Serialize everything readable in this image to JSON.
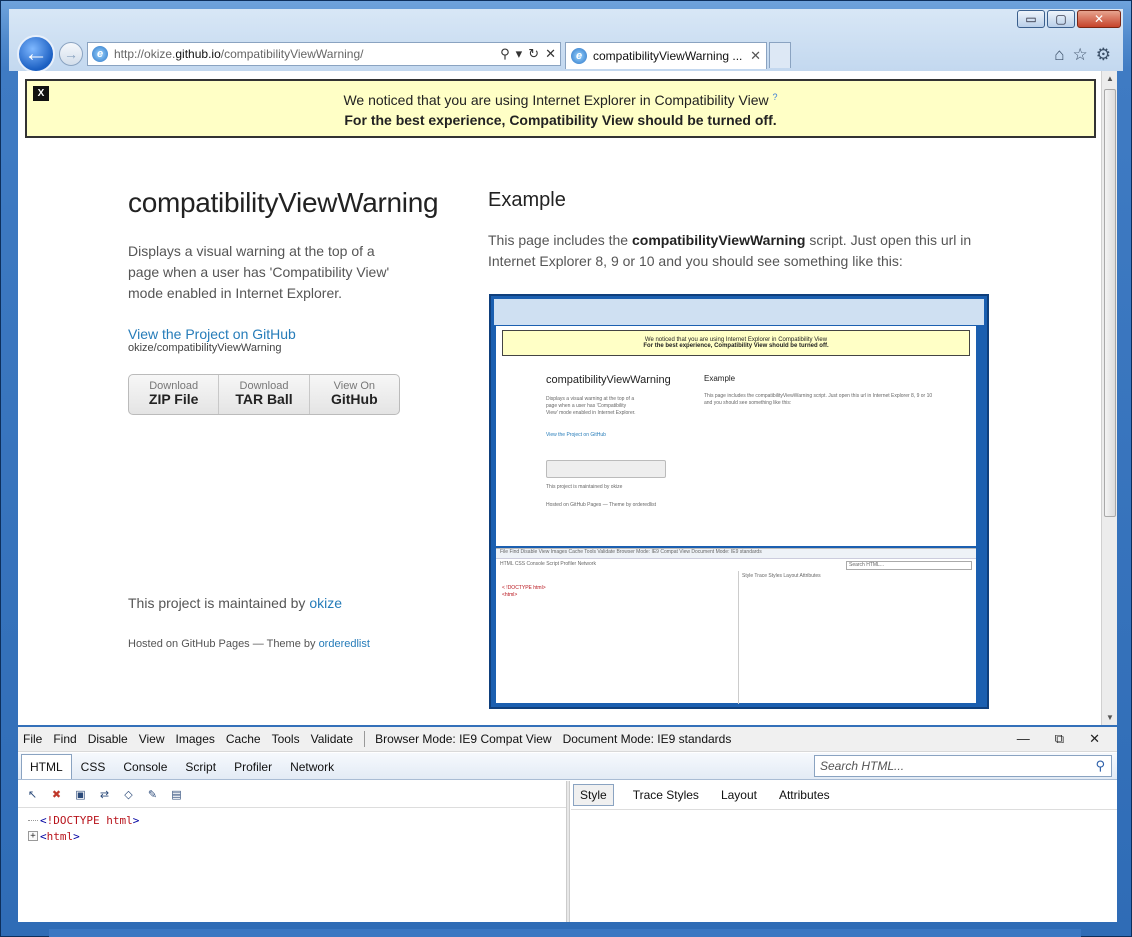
{
  "browser": {
    "address_url_prefix": "http://okize.",
    "address_url_domain": "github.io",
    "address_url_path": "/compatibilityViewWarning/",
    "tab_title": "compatibilityViewWarning ...",
    "window_controls": {
      "minimize": "▭",
      "maximize": "▢",
      "close": "✕"
    }
  },
  "banner": {
    "close_label": "X",
    "line1": "We noticed that you are using Internet Explorer in Compatibility View",
    "help_mark": "?",
    "line2": "For the best experience, Compatibility View should be turned off."
  },
  "page": {
    "title": "compatibilityViewWarning",
    "description": "Displays a visual warning at the top of a page when a user has 'Compatibility View' mode enabled in Internet Explorer.",
    "github_link": "View the Project on GitHub",
    "github_sub": "okize/compatibilityViewWarning",
    "downloads": [
      {
        "small": "Download",
        "big": "ZIP File"
      },
      {
        "small": "Download",
        "big": "TAR Ball"
      },
      {
        "small": "View On",
        "big": "GitHub"
      }
    ],
    "maintained_prefix": "This project is maintained by ",
    "maintained_user": "okize",
    "hosted_prefix": "Hosted on GitHub Pages — Theme by ",
    "hosted_theme": "orderedlist",
    "example_heading": "Example",
    "example_text_before": "This page includes the ",
    "example_text_bold": "compatibilityViewWarning",
    "example_text_after": " script. Just open this url in Internet Explorer 8, 9 or 10 and you should see something like this:"
  },
  "thumbnail": {
    "banner_line1": "We noticed that you are using Internet Explorer in Compatibility View",
    "banner_line2": "For the best experience, Compatibility View should be turned off.",
    "title": "compatibilityViewWarning",
    "example": "Example",
    "desc": "Displays a visual warning at the top of a page when a user has 'Compatibility View' mode enabled in Internet Explorer.",
    "example_text": "This page includes the compatibilityViewWarning script. Just open this url in Internet Explorer 8, 9 or 10 and you should see something like this:",
    "link": "View the Project on GitHub",
    "maint": "This project is maintained by okize",
    "hosted": "Hosted on GitHub Pages — Theme by orderedlist",
    "dev_menu": "File  Find  Disable  View  Images  Cache  Tools  Validate  Browser Mode: IE9 Compat View  Document Mode: IE9 standards",
    "dev_tabs": "HTML   CSS   Console   Script   Profiler   Network",
    "dev_right_tabs": "Style   Trace Styles   Layout   Attributes",
    "dev_search": "Search HTML...",
    "dev_tree": "< !DOCTYPE html>",
    "dev_tree2": "<html>"
  },
  "devtools": {
    "menu": [
      "File",
      "Find",
      "Disable",
      "View",
      "Images",
      "Cache",
      "Tools",
      "Validate"
    ],
    "browser_mode": "Browser Mode: IE9 Compat View",
    "document_mode": "Document Mode: IE9 standards",
    "tabs": [
      "HTML",
      "CSS",
      "Console",
      "Script",
      "Profiler",
      "Network"
    ],
    "active_tab": "HTML",
    "search_placeholder": "Search HTML...",
    "tree": {
      "doctype": "!DOCTYPE html",
      "html": "html"
    },
    "right_tabs": [
      "Style",
      "Trace Styles",
      "Layout",
      "Attributes"
    ],
    "active_right_tab": "Style"
  }
}
